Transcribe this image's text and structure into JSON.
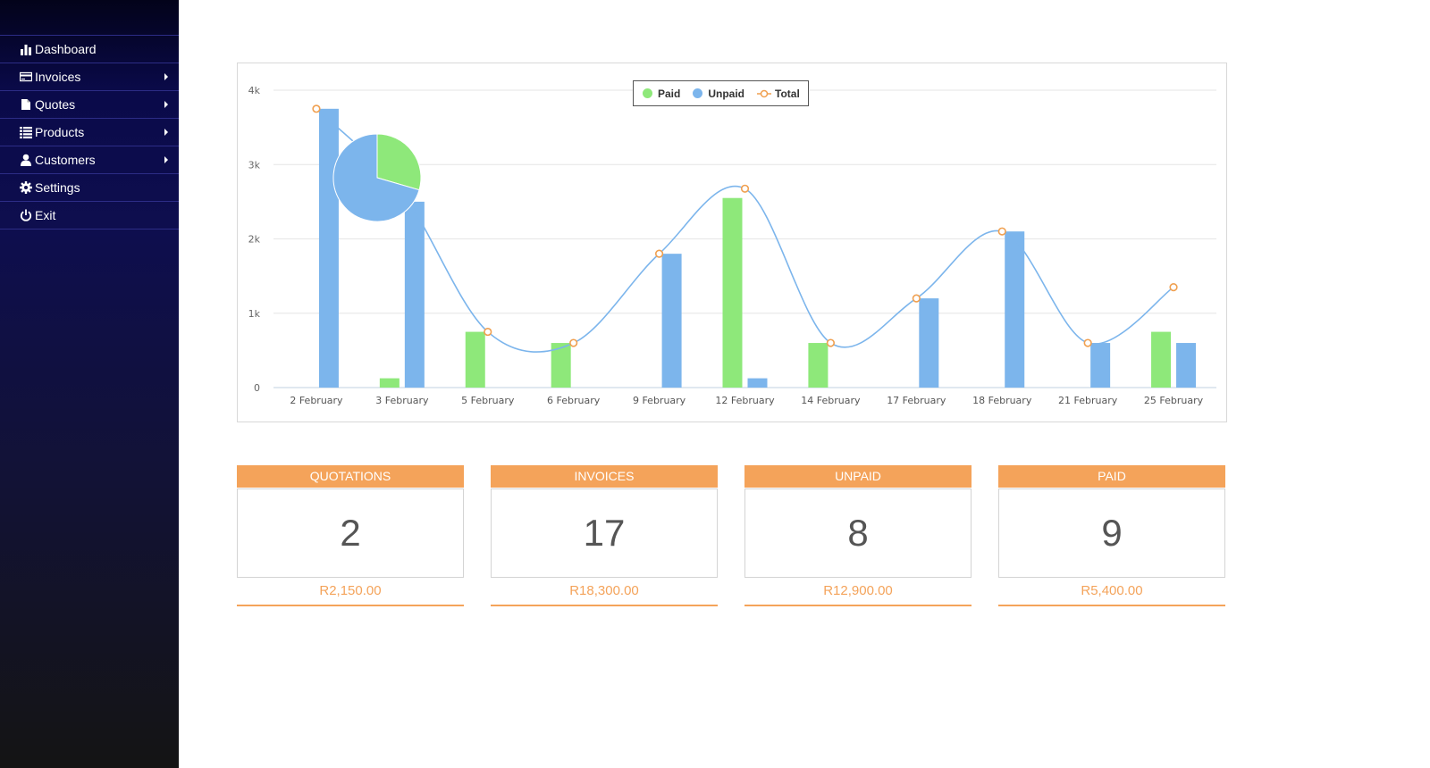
{
  "colors": {
    "paid": "#8ee87a",
    "unpaid": "#7cb5ec",
    "total_line": "#7cb5ec",
    "total_marker": "#f0a050",
    "accent": "#f4a35a"
  },
  "sidebar": {
    "items": [
      {
        "label": "Dashboard",
        "icon": "bar-chart-icon",
        "has_submenu": false
      },
      {
        "label": "Invoices",
        "icon": "credit-card-icon",
        "has_submenu": true
      },
      {
        "label": "Quotes",
        "icon": "file-icon",
        "has_submenu": true
      },
      {
        "label": "Products",
        "icon": "list-icon",
        "has_submenu": true
      },
      {
        "label": "Customers",
        "icon": "user-icon",
        "has_submenu": true
      },
      {
        "label": "Settings",
        "icon": "gear-icon",
        "has_submenu": false
      },
      {
        "label": "Exit",
        "icon": "power-icon",
        "has_submenu": false
      }
    ]
  },
  "legend": {
    "paid": "Paid",
    "unpaid": "Unpaid",
    "total": "Total"
  },
  "chart_data": [
    {
      "type": "bar",
      "categories": [
        "2 February",
        "3 February",
        "5 February",
        "6 February",
        "9 February",
        "12 February",
        "14 February",
        "17 February",
        "18 February",
        "21 February",
        "25 February"
      ],
      "series": [
        {
          "name": "Paid",
          "type": "bar",
          "values": [
            0,
            125,
            750,
            600,
            0,
            2550,
            600,
            0,
            0,
            0,
            750
          ]
        },
        {
          "name": "Unpaid",
          "type": "bar",
          "values": [
            3750,
            2500,
            0,
            0,
            1800,
            125,
            0,
            1200,
            2100,
            600,
            600
          ]
        },
        {
          "name": "Total",
          "type": "line",
          "values": [
            3750,
            2625,
            750,
            600,
            1800,
            2675,
            600,
            1200,
            2100,
            600,
            1350
          ]
        }
      ],
      "y_ticks": [
        "0",
        "1k",
        "2k",
        "3k",
        "4k"
      ],
      "ylim": [
        0,
        4000
      ],
      "grid": true,
      "legend_position": "top-center"
    },
    {
      "type": "pie",
      "labels": [
        "Paid",
        "Unpaid"
      ],
      "values": [
        5400,
        12900
      ]
    }
  ],
  "stats": [
    {
      "title": "QUOTATIONS",
      "count": "2",
      "amount": "R2,150.00"
    },
    {
      "title": "INVOICES",
      "count": "17",
      "amount": "R18,300.00"
    },
    {
      "title": "UNPAID",
      "count": "8",
      "amount": "R12,900.00"
    },
    {
      "title": "PAID",
      "count": "9",
      "amount": "R5,400.00"
    }
  ]
}
